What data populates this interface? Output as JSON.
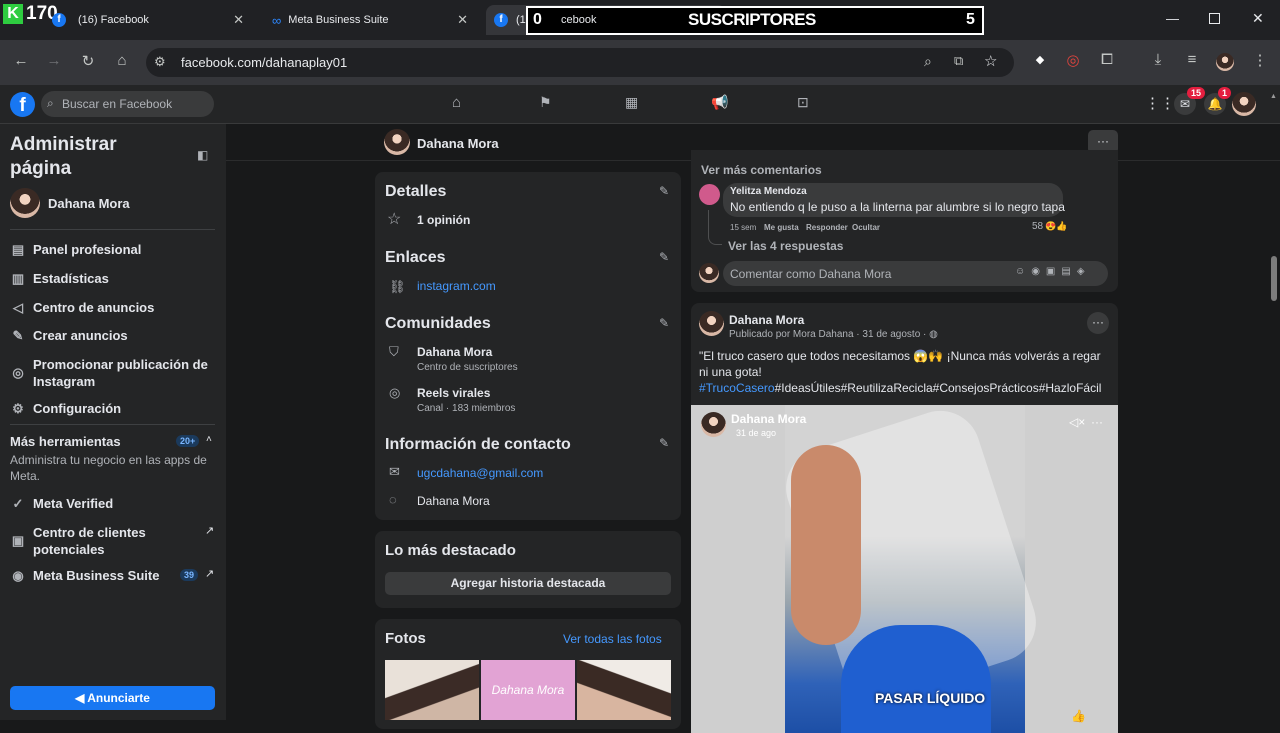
{
  "overlay": {
    "top_count": "170",
    "subscribers_label": "SUSCRIPTORES",
    "subscribers_value": "0",
    "plus_value": "5"
  },
  "tabs": [
    {
      "title": "(16) Facebook"
    },
    {
      "title": "Meta Business Suite"
    },
    {
      "title_left": "(1",
      "title_mid": "cebook",
      "title_right": "hboard"
    }
  ],
  "address": {
    "url": "facebook.com/dahanaplay01"
  },
  "fb": {
    "search_placeholder": "Buscar en Facebook",
    "messenger_badge": "15",
    "notif_badge": "1"
  },
  "sidebar": {
    "title": "Administrar página",
    "page_name": "Dahana Mora",
    "items": [
      {
        "label": "Panel profesional",
        "icon": "panel-icon"
      },
      {
        "label": "Estadísticas",
        "icon": "stats-icon"
      },
      {
        "label": "Centro de anuncios",
        "icon": "megaphone-icon"
      },
      {
        "label": "Crear anuncios",
        "icon": "pencil-icon"
      },
      {
        "label": "Promocionar publicación de Instagram",
        "icon": "instagram-icon"
      },
      {
        "label": "Configuración",
        "icon": "gear-icon"
      }
    ],
    "more_tools": {
      "label": "Más herramientas",
      "badge": "20+",
      "desc": "Administra tu negocio en las apps de Meta."
    },
    "tools": [
      {
        "label": "Meta Verified"
      },
      {
        "label": "Centro de clientes potenciales"
      },
      {
        "label": "Meta Business Suite",
        "badge": "39"
      }
    ],
    "advertise_button": "Anunciarte"
  },
  "page_header": {
    "name": "Dahana Mora",
    "more": "···"
  },
  "details": {
    "title": "Detalles",
    "rating": "1 opinión"
  },
  "links": {
    "title": "Enlaces",
    "instagram": "instagram.com"
  },
  "communities": {
    "title": "Comunidades",
    "items": [
      {
        "name": "Dahana Mora",
        "sub": "Centro de suscriptores"
      },
      {
        "name": "Reels virales",
        "sub": "Canal · 183 miembros"
      }
    ]
  },
  "contact": {
    "title": "Información de contacto",
    "email": "ugcdahana@gmail.com",
    "messenger": "Dahana Mora"
  },
  "highlights": {
    "title": "Lo más destacado",
    "button": "Agregar historia destacada"
  },
  "photos": {
    "title": "Fotos",
    "see_all": "Ver todas las fotos",
    "photo2_text": "Dahana Mora"
  },
  "comments": {
    "see_more": "Ver más comentarios",
    "author": "Yelitza Mendoza",
    "text": "No entiendo q le puso a la linterna par alumbre si lo negro tapa",
    "time": "15 sem",
    "like": "Me gusta",
    "reply": "Responder",
    "hide": "Ocultar",
    "reactions": "58",
    "replies": "Ver las 4 respuestas",
    "input_placeholder": "Comentar como Dahana Mora"
  },
  "post": {
    "author": "Dahana Mora",
    "published_by": "Publicado por Mora Dahana",
    "date": "31 de agosto",
    "text": "\"El truco casero que todos necesitamos 😱🙌 ¡Nunca más volverás a regar ni una gota!",
    "hashtag1": "#TrucoCasero",
    "hashtags_rest": "#IdeasÚtiles#ReutilizaRecicla#ConsejosPrácticos#HazloFácil",
    "video_author": "Dahana Mora",
    "video_date": "31 de ago",
    "caption": "PASAR LÍQUIDO"
  }
}
